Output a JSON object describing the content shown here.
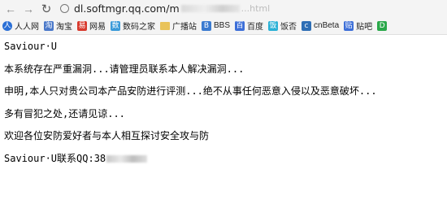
{
  "browser": {
    "url_host": "dl.softmgr.qq.com/",
    "url_visible_prefix": "m",
    "url_tail": "...html"
  },
  "bookmarks": [
    {
      "label": "人人网",
      "icon": "renren-icon",
      "color": "#2a6fd6",
      "glyph": "人"
    },
    {
      "label": "淘宝",
      "icon": "taobao-icon",
      "color": "#4a78c9",
      "glyph": "淘"
    },
    {
      "label": "网易",
      "icon": "netease-icon",
      "color": "#d83a2e",
      "glyph": "易"
    },
    {
      "label": "数码之家",
      "icon": "mydigit-icon",
      "color": "#3a9ad9",
      "glyph": "数"
    },
    {
      "label": "广播站",
      "icon": "folder-icon",
      "color": "#e9c35a",
      "glyph": ""
    },
    {
      "label": "BBS",
      "icon": "bbs-icon",
      "color": "#3b7bd0",
      "glyph": "B"
    },
    {
      "label": "百度",
      "icon": "baidu-icon",
      "color": "#3d6fd8",
      "glyph": "百"
    },
    {
      "label": "饭否",
      "icon": "fanfou-icon",
      "color": "#2ab1d6",
      "glyph": "饭"
    },
    {
      "label": "cnBeta",
      "icon": "cnbeta-icon",
      "color": "#2f6fb5",
      "glyph": "c"
    },
    {
      "label": "贴吧",
      "icon": "tieba-icon",
      "color": "#3d6fd8",
      "glyph": "贴"
    },
    {
      "label": "",
      "icon": "green-app-icon",
      "color": "#2aa84a",
      "glyph": "D"
    }
  ],
  "content": {
    "line1": "Saviour·U",
    "line2": "本系统存在严重漏洞...请管理员联系本人解决漏洞...",
    "line3": "申明,本人只对贵公司本产品安防进行评测...绝不从事任何恶意入侵以及恶意破坏...",
    "line4": "多有冒犯之处,还请见谅...",
    "line5": "欢迎各位安防爱好者与本人相互探讨安全攻与防",
    "line6_prefix": "Saviour·U联系QQ:38"
  }
}
